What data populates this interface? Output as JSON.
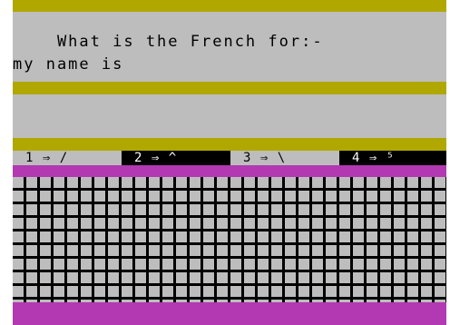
{
  "question": {
    "line1": "    What is the French for:-",
    "line2": "my name is"
  },
  "answer": "",
  "choices": [
    {
      "label": "1 ⇒ /",
      "style": "light"
    },
    {
      "label": "2 ⇒ ^",
      "style": "dark"
    },
    {
      "label": "3 ⇒ \\",
      "style": "light"
    },
    {
      "label": "4 ⇒ ⁵",
      "style": "dark"
    }
  ],
  "colors": {
    "olive": "#b0a800",
    "grey": "#bdbdbd",
    "magenta": "#b239b2",
    "black": "#000000"
  }
}
